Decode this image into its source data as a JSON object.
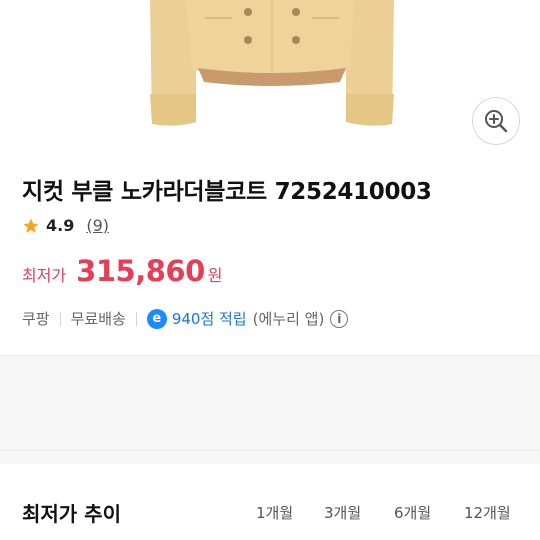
{
  "product": {
    "title": "지컷 부클 노카라더블코트 7252410003",
    "rating": {
      "score": "4.9",
      "count": "(9)"
    },
    "price": {
      "label": "최저가",
      "amount": "315,860",
      "currency": "원"
    },
    "seller": "쿠팡",
    "shipping": "무료배송",
    "reward": {
      "badge": "e",
      "points": "940점 적립",
      "note": "(에누리 앱)"
    }
  },
  "price_trend": {
    "title": "최저가 추이",
    "periods": [
      "1개월",
      "3개월",
      "6개월",
      "12개월"
    ]
  },
  "colors": {
    "accent": "#e63e57",
    "link": "#1a73e8",
    "star": "#f5a623"
  },
  "icons": {
    "zoom": "zoom-in-icon",
    "star": "star-icon",
    "info": "info-icon"
  }
}
